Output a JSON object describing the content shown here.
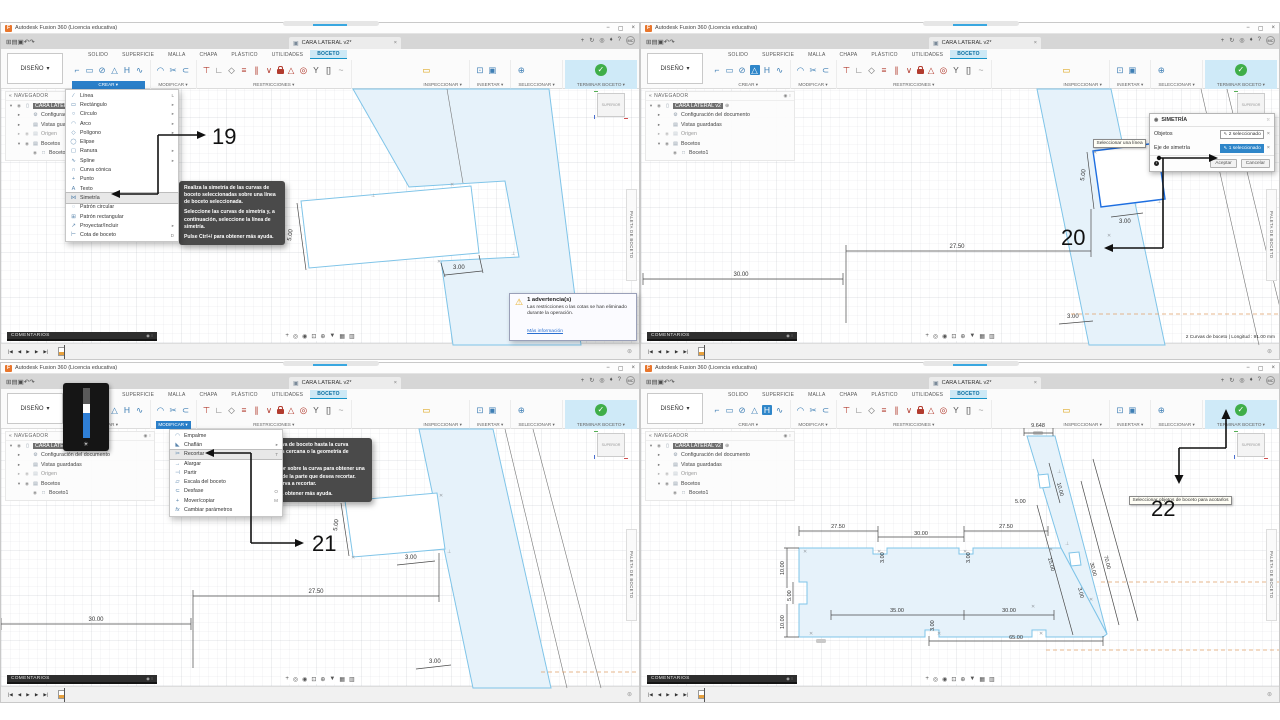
{
  "app": {
    "title": "Autodesk Fusion 360 (Licencia educativa)",
    "doc_tab": "CARA LATERAL v2*",
    "avatar": "MC",
    "win_min": "−",
    "win_max": "▢",
    "win_close": "×",
    "tab_close": "×",
    "tab_add": "+",
    "quick_icons": [
      [
        "app-grid-icon",
        "⊞"
      ],
      [
        "file-menu-icon",
        "▤"
      ],
      [
        "save-icon",
        "▣"
      ],
      [
        "undo-icon",
        "↶"
      ],
      [
        "redo-icon",
        "↷"
      ]
    ],
    "account_icons": [
      [
        "sync-icon",
        "↻"
      ],
      [
        "extensions-icon",
        "◎"
      ],
      [
        "notifications-icon",
        "♦"
      ],
      [
        "help-icon",
        "?"
      ]
    ]
  },
  "ribbon": {
    "design": "DISEÑO",
    "tabs": [
      "SOLIDO",
      "SUPERFICIE",
      "MALLA",
      "CHAPA",
      "PLÁSTICO",
      "UTILIDADES",
      "BOCETO"
    ],
    "active_tab": "BOCETO",
    "groups": [
      {
        "label": "CREAR",
        "icons": [
          [
            "sketch-line-icon",
            "⌐",
            "#3f7fb5"
          ],
          [
            "rectangle-icon",
            "▭",
            "#3f7fb5"
          ],
          [
            "circle-icon",
            "⊘",
            "#3f7fb5"
          ],
          [
            "mirror-icon",
            "△",
            "#3f7fb5"
          ],
          [
            "slot-icon",
            "H",
            "#3f7fb5"
          ],
          [
            "spline-icon",
            "∿",
            "#3f7fb5"
          ]
        ]
      },
      {
        "label": "MODIFICAR",
        "icons": [
          [
            "fillet-icon",
            "◠",
            "#3f7fb5"
          ],
          [
            "trim-icon",
            "✂",
            "#3f7fb5"
          ],
          [
            "offset-icon",
            "⊂",
            "#3f7fb5"
          ]
        ]
      },
      {
        "label": "RESTRICCIONES",
        "icons": [
          [
            "sketch-dimension-icon",
            "⊤",
            "#b23b2e"
          ],
          [
            "horizontal-vertical-icon",
            "∟",
            "#666666"
          ],
          [
            "tangent-icon",
            "◇",
            "#666666"
          ],
          [
            "equal-icon",
            "≡",
            "#b23b2e"
          ],
          [
            "parallel-icon",
            "∥",
            "#b23b2e"
          ],
          [
            "perpendicular-icon",
            "∨",
            "#b23b2e"
          ],
          [
            "lock-icon",
            "LOCK",
            "#b23b2e"
          ],
          [
            "fix-icon",
            "△",
            "#b23b2e"
          ],
          [
            "concentric-icon",
            "◎",
            "#b23b2e"
          ],
          [
            "midpoint-icon",
            "Y",
            "#555555"
          ],
          [
            "symmetry-icon",
            "[]",
            "#555555"
          ],
          [
            "curvature-icon",
            "~",
            "#999999"
          ]
        ]
      },
      {
        "label": "INSPECCIONAR",
        "icons": [
          [
            "measure-icon",
            "▭",
            "#d99b00"
          ]
        ]
      },
      {
        "label": "INSERTAR",
        "icons": [
          [
            "insert-icon",
            "⊡",
            "#3f7fb5"
          ],
          [
            "canvas-image-icon",
            "▣",
            "#3f7fb5"
          ]
        ]
      },
      {
        "label": "SELECCIONAR",
        "icons": [
          [
            "select-icon",
            "⊕",
            "#3f7fb5"
          ]
        ]
      },
      {
        "label": "TERMINAR BOCETO",
        "icons": [
          [
            "finish-sketch-icon",
            "CHECK",
            "#3fae49"
          ]
        ]
      }
    ]
  },
  "navigator": {
    "title": "NAVEGADOR",
    "items": [
      {
        "label": "CARA LATERAL v2",
        "icon": "▯",
        "exp": "▾",
        "eye": true,
        "level": 0,
        "sel": true,
        "badge": "⊕"
      },
      {
        "label": "Configuración del documento",
        "icon": "⚙",
        "exp": "▸",
        "eye": false,
        "level": 1
      },
      {
        "label": "Vistas guardadas",
        "icon": "▤",
        "exp": "▸",
        "eye": false,
        "level": 1
      },
      {
        "label": "Origen",
        "icon": "▤",
        "exp": "▸",
        "eye": true,
        "level": 1,
        "dim": true
      },
      {
        "label": "Bocetos",
        "icon": "▤",
        "exp": "▾",
        "eye": true,
        "level": 1
      },
      {
        "label": "Boceto1",
        "icon": "□",
        "exp": "",
        "eye": true,
        "level": 2
      }
    ]
  },
  "canvas": {
    "viewcube": "SUPERIOR",
    "palette": "PALETA DE BOCETO",
    "comments": "COMENTARIOS",
    "view_toolbar": [
      [
        "pan-icon",
        "+"
      ],
      [
        "orbit-icon",
        "◎"
      ],
      [
        "look-at-icon",
        "◉"
      ],
      [
        "zoom-window-icon",
        "⊡"
      ],
      [
        "zoom-icon",
        "⊕"
      ],
      [
        "display-settings-icon",
        "▼"
      ],
      [
        "grid-settings-icon",
        "▦"
      ],
      [
        "viewports-icon",
        "▥"
      ]
    ],
    "timeline_icons": [
      [
        "go-start-icon",
        "|◀"
      ],
      [
        "step-back-icon",
        "◀"
      ],
      [
        "play-icon",
        "▶"
      ],
      [
        "step-forward-icon",
        "▶"
      ],
      [
        "go-end-icon",
        "▶|"
      ]
    ]
  },
  "quadrants": [
    {
      "step": "19",
      "open_group": "CREAR",
      "menu": {
        "items": [
          {
            "icon": "∕",
            "label": "Línea",
            "right": "L"
          },
          {
            "icon": "▭",
            "label": "Rectángulo",
            "right": "▸"
          },
          {
            "icon": "○",
            "label": "Círculo",
            "right": "▸"
          },
          {
            "icon": "◠",
            "label": "Arco",
            "right": "▸"
          },
          {
            "icon": "◇",
            "label": "Polígono",
            "right": "▸"
          },
          {
            "icon": "◯",
            "label": "Elipse",
            "right": ""
          },
          {
            "icon": "▢",
            "label": "Ranura",
            "right": "▸"
          },
          {
            "icon": "∿",
            "label": "Spline",
            "right": "▸"
          },
          {
            "icon": "∩",
            "label": "Curva cónica",
            "right": ""
          },
          {
            "icon": "+",
            "label": "Punto",
            "right": ""
          },
          {
            "icon": "A",
            "label": "Texto",
            "right": ""
          },
          {
            "icon": "⋈",
            "label": "Simetría",
            "right": "",
            "hl": true
          },
          {
            "icon": "◌",
            "label": "Patrón circular",
            "right": ""
          },
          {
            "icon": "⊞",
            "label": "Patrón rectangular",
            "right": ""
          },
          {
            "icon": "↗",
            "label": "Proyectar/Incluir",
            "right": "▸"
          },
          {
            "icon": "⊢",
            "label": "Cota de boceto",
            "right": "D"
          }
        ]
      },
      "tooltip": {
        "p1": "Realiza la simetría de las curvas de boceto seleccionadas sobre una línea de boceto seleccionada.",
        "p2": "Seleccione las curvas de simetría y, a continuación, seleccione la línea de simetría.",
        "p3": "Pulse Ctrl+/ para obtener más ayuda."
      },
      "warning": {
        "title": "1 advertencia(s)",
        "body": "Las restricciones o las cotas se han eliminado durante la operación.",
        "link": "Más información"
      },
      "dims": [
        "5.00",
        "3.00"
      ]
    },
    {
      "step": "20",
      "active_icon": [
        0,
        3
      ],
      "dialog": {
        "title": "SIMETRÍA",
        "rows": [
          {
            "label": "Objetos",
            "value": "2 seleccionado",
            "active": false
          },
          {
            "label": "Eje de simetría",
            "value": "1 seleccionado",
            "active": true
          }
        ],
        "ok": "Aceptar",
        "cancel": "Cancelar"
      },
      "hint": "Seleccionar una línea",
      "status": "2 Curvas de boceto | Longitud : 91.00 mm",
      "dims": [
        "27.50",
        "30.00",
        "5.00",
        "3.00",
        "3.00"
      ]
    },
    {
      "step": "21",
      "open_group": "MODIFICAR",
      "slider": true,
      "menu": {
        "items": [
          {
            "icon": "◠",
            "label": "Empalme",
            "right": ""
          },
          {
            "icon": "◣",
            "label": "Chaflán",
            "right": "▸"
          },
          {
            "icon": "✂",
            "label": "Recortar",
            "right": "T",
            "hl": true
          },
          {
            "icon": "→",
            "label": "Alargar",
            "right": ""
          },
          {
            "icon": "⊣",
            "label": "Partir",
            "right": ""
          },
          {
            "icon": "▱",
            "label": "Escala del boceto",
            "right": ""
          },
          {
            "icon": "⊂",
            "label": "Desfase",
            "right": "O"
          },
          {
            "icon": "+",
            "label": "Mover/copiar",
            "right": "M"
          },
          {
            "icon": "fx",
            "label": "Cambiar parámetros",
            "right": ""
          }
        ]
      },
      "tooltip": {
        "p1": "Recorta una curva de boceto hasta la curva intersecante más cercana o la geometría de contorno.",
        "p2": "Detenga el cursor sobre la curva para obtener una vista preliminar de la parte que desea recortar. Seleccione la curva a recortar.",
        "p3": "Pulse Ctrl+/ para obtener más ayuda."
      },
      "dims": [
        "30.00",
        "27.50",
        "5.00",
        "3.00",
        "3.00"
      ]
    },
    {
      "step": "22",
      "active_icon": [
        0,
        4
      ],
      "hint": "Seleccionar objetos de boceto para acotarlos",
      "dims": [
        "9.648",
        "27.50",
        "30.00",
        "27.50",
        "35.00",
        "30.00",
        "65.00",
        "10.00",
        "5.00",
        "10.00",
        "15.00",
        "30.00",
        "70.00",
        "10.00",
        "5.00",
        "3.00",
        "3.00",
        "3.00",
        "3.00"
      ]
    }
  ]
}
